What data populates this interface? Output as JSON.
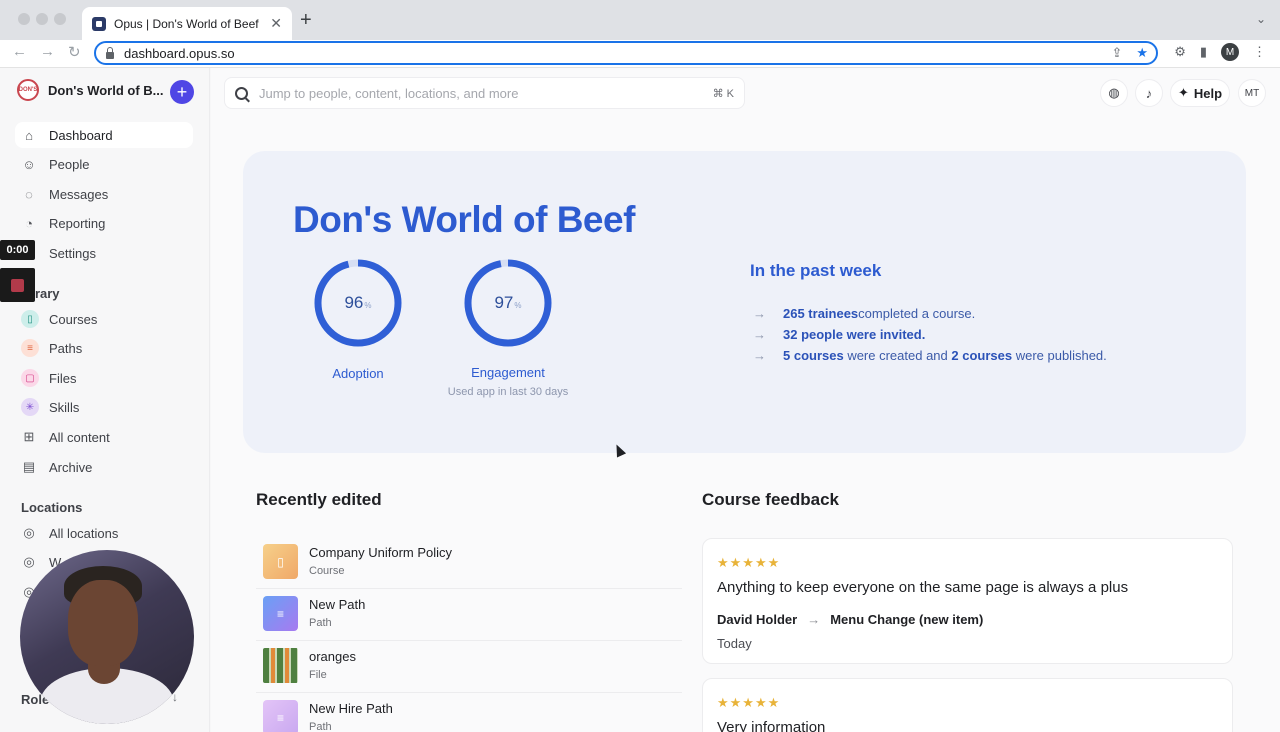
{
  "browser": {
    "tab_title": "Opus | Don's World of Beef",
    "url": "dashboard.opus.so",
    "profile_initial": "M"
  },
  "sidebar": {
    "org_name": "Don's World of B...",
    "org_logo_text": "DON'S",
    "add_label": "+",
    "nav": [
      {
        "label": "Dashboard",
        "icon": "home-icon"
      },
      {
        "label": "People",
        "icon": "person-icon"
      },
      {
        "label": "Messages",
        "icon": "chat-icon"
      },
      {
        "label": "Reporting",
        "icon": "chart-icon"
      },
      {
        "label": "Settings",
        "icon": "gear-icon"
      }
    ],
    "library_label": "brary",
    "library": [
      {
        "label": "Courses",
        "icon": "bookmark-icon",
        "color": "#cdeeea"
      },
      {
        "label": "Paths",
        "icon": "list-icon",
        "color": "#fde0d6"
      },
      {
        "label": "Files",
        "icon": "file-icon",
        "color": "#fbd8e8"
      },
      {
        "label": "Skills",
        "icon": "asterisk-icon",
        "color": "#e4d8f6"
      },
      {
        "label": "All content",
        "icon": "grid-icon"
      },
      {
        "label": "Archive",
        "icon": "archive-icon"
      }
    ],
    "locations_label": "Locations",
    "locations": [
      {
        "label": "All locations"
      },
      {
        "label": "W"
      },
      {
        "label": ""
      }
    ],
    "roles_label": "Role",
    "recording_time": "0:00"
  },
  "header": {
    "search_placeholder": "Jump to people, content, locations, and more",
    "search_shortcut": "⌘ K",
    "help_label": "Help",
    "avatar_initials": "MT"
  },
  "hero": {
    "title": "Don's World of Beef",
    "metrics": [
      {
        "value": "96",
        "unit": "%",
        "label": "Adoption",
        "sub": "",
        "fraction": 0.96
      },
      {
        "value": "97",
        "unit": "%",
        "label": "Engagement",
        "sub": "Used app in last 30 days",
        "fraction": 0.97
      }
    ],
    "week_title": "In the past week",
    "week": [
      {
        "bold1": "265 trainees",
        "text1": " completed a course.",
        "bold2": "",
        "text2": ""
      },
      {
        "bold1": "32 people were invited.",
        "text1": "",
        "bold2": "",
        "text2": ""
      },
      {
        "bold1": "5 courses",
        "text1": " were created and ",
        "bold2": "2 courses",
        "text2": " were published."
      }
    ]
  },
  "recent": {
    "title": "Recently edited",
    "items": [
      {
        "title": "Company Uniform Policy",
        "type": "Course",
        "color": "#f3c77e"
      },
      {
        "title": "New Path",
        "type": "Path",
        "color": "#8b7cf0"
      },
      {
        "title": "oranges",
        "type": "File",
        "color": "#5b8a4a"
      },
      {
        "title": "New Hire Path",
        "type": "Path",
        "color": "#d9b6f2"
      }
    ]
  },
  "feedback": {
    "title": "Course feedback",
    "items": [
      {
        "stars": "★★★★★",
        "rating": 5,
        "text": "Anything to keep everyone on the same page is always a plus",
        "author": "David Holder",
        "course": "Menu Change (new item)",
        "date": "Today"
      },
      {
        "stars": "★★★★★",
        "rating": 5,
        "text": "Very information",
        "author": "",
        "course": "",
        "date": ""
      }
    ]
  },
  "colors": {
    "accent": "#2d5bd0",
    "ring": "#2f5fd6",
    "add_button": "#4f46e5",
    "star": "#e8b339"
  }
}
